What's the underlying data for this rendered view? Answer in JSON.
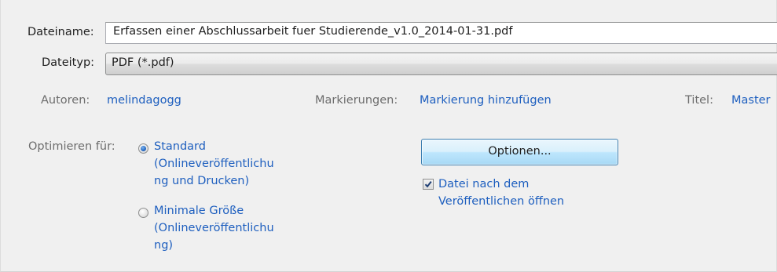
{
  "filename": {
    "label": "Dateiname:",
    "value": "Erfassen einer Abschlussarbeit fuer Studierende_v1.0_2014-01-31.pdf"
  },
  "filetype": {
    "label": "Dateityp:",
    "value": "PDF (*.pdf)"
  },
  "meta": {
    "authors_label": "Autoren:",
    "authors_value": "melindagogg",
    "tags_label": "Markierungen:",
    "tags_value": "Markierung hinzufügen",
    "title_label": "Titel:",
    "title_value": "Master"
  },
  "optimize": {
    "label": "Optimieren für:",
    "standard_lines": [
      "Standard",
      "(Onlineveröffentlichu",
      "ng und Drucken)"
    ],
    "minimal_lines": [
      "Minimale Größe",
      "(Onlineveröffentlichu",
      "ng)"
    ],
    "selected": "standard"
  },
  "options_button": "Optionen...",
  "open_after_publish": {
    "checked": true,
    "lines": [
      "Datei nach dem",
      "Veröffentlichen öffnen"
    ]
  }
}
